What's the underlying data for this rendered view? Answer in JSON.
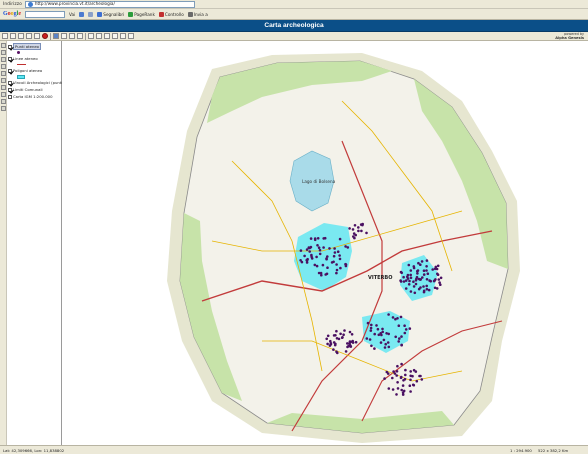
{
  "browser": {
    "address_label": "Indirizzo",
    "url": "http://www.provincia.vt.it/archeologia/",
    "google_logo": [
      "G",
      "o",
      "o",
      "g",
      "l",
      "e"
    ],
    "google_search_value": "",
    "go_label": "Vai",
    "toolbar_items": [
      "Segnalibri",
      "PageRank",
      "Controllo",
      "Invia a"
    ]
  },
  "app": {
    "title": "Carta archeologica",
    "powered_line1": "powered by",
    "powered_line2": "Alpha Genesis"
  },
  "layers": [
    {
      "label": "Punti ateneo",
      "checked": true,
      "selected": true,
      "swatch": "purple-point"
    },
    {
      "label": "Linee ateneo",
      "checked": true,
      "selected": false,
      "swatch": "red-line"
    },
    {
      "label": "Poligoni ateneo",
      "checked": true,
      "selected": false,
      "swatch": "cyan-polygon"
    },
    {
      "label": "Vincoli Archeologici (punti)",
      "checked": true,
      "selected": false,
      "swatch": ""
    },
    {
      "label": "Limiti Comunali",
      "checked": true,
      "selected": false,
      "swatch": ""
    },
    {
      "label": "Carta IGM 1:200.000",
      "checked": false,
      "selected": false,
      "swatch": ""
    }
  ],
  "map": {
    "labels": {
      "lake": "Lago di Bolsena",
      "city": "VITERBO"
    },
    "colors": {
      "land": "#f3f2ea",
      "park": "#c7e3a9",
      "coast": "#e6e6d0",
      "sea": "#ffffff",
      "lake": "#a9dbe9",
      "polygon": "#5be6f3",
      "point": "#4a1162",
      "road_main": "#c23b3b",
      "road_minor": "#e6b400",
      "boundary": "#8a8a8a"
    }
  },
  "status": {
    "coords": "Lat: 42,309666, Lon: 11,838802",
    "scale": "1 : 294.900",
    "extent": "522 x 382,2 Km"
  }
}
